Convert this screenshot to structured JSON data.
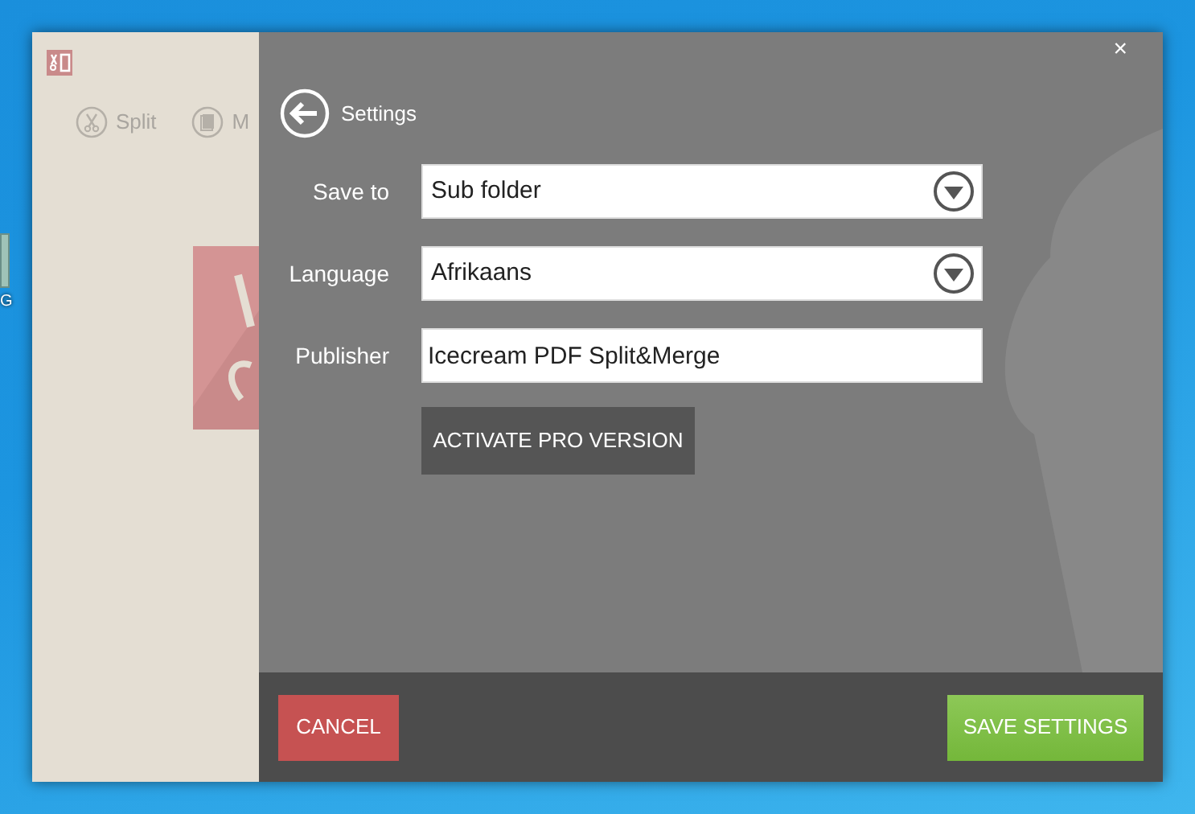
{
  "desktop_icon": {
    "label": "G"
  },
  "app": {
    "toolbar": [
      {
        "label": "Split",
        "kind": "split"
      },
      {
        "label": "M",
        "kind": "merge"
      }
    ]
  },
  "settings": {
    "title": "Settings",
    "fields": [
      {
        "label": "Save to",
        "value": "Sub folder",
        "kind": "dropdown"
      },
      {
        "label": "Language",
        "value": "Afrikaans",
        "kind": "dropdown"
      },
      {
        "label": "Publisher",
        "value": "Icecream PDF Split&Merge",
        "kind": "text"
      }
    ],
    "activate_button": "ACTIVATE PRO VERSION",
    "close": "×",
    "cancel_button": "CANCEL",
    "save_button": "SAVE SETTINGS"
  }
}
